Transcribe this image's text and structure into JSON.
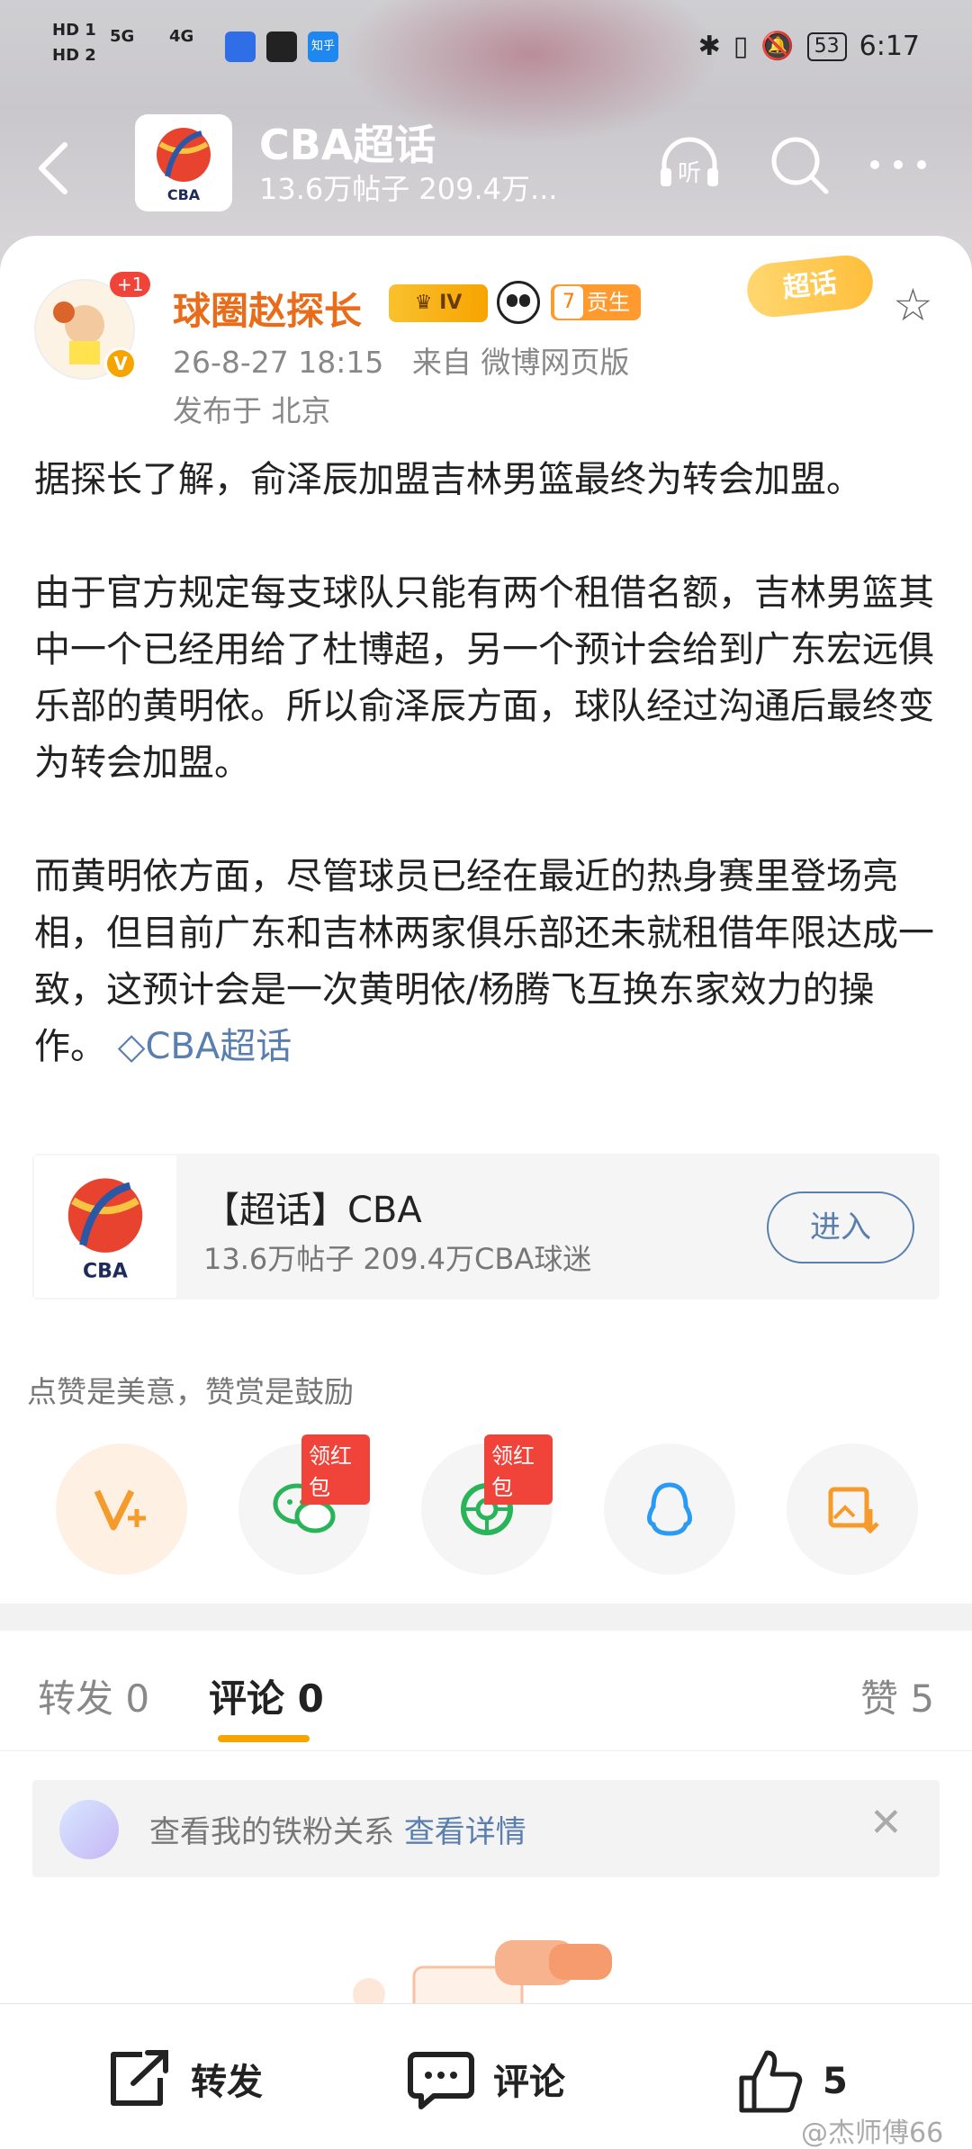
{
  "status_bar": {
    "hd1": "HD 1",
    "hd2": "HD 2",
    "net1": "5G",
    "net2": "4G",
    "zhihu": "知乎",
    "battery": "53",
    "time": "6:17"
  },
  "header": {
    "title": "CBA超话",
    "subtitle": "13.6万帖子 209.4万...",
    "logo_text": "CBA",
    "listen_label": "听"
  },
  "post": {
    "author": "球圈赵探长",
    "avatar_badge": "+1",
    "verified": "V",
    "level": "IV",
    "contrib_num": "7",
    "contrib_label": "贡生",
    "time": "26-8-27 18:15",
    "source": "来自 微博网页版",
    "location": "发布于 北京",
    "chaohua_tag": "超话",
    "paragraphs": [
      "据探长了解，俞泽辰加盟吉林男篮最终为转会加盟。",
      "由于官方规定每支球队只能有两个租借名额，吉林男篮其中一个已经用给了杜博超，另一个预计会给到广东宏远俱乐部的黄明依。所以俞泽辰方面，球队经过沟通后最终变为转会加盟。",
      "而黄明依方面，尽管球员已经在最近的热身赛里登场亮相，但目前广东和吉林两家俱乐部还未就租借年限达成一致，这预计会是一次黄明依/杨腾飞互换东家效力的操作。"
    ],
    "topic_link": "CBA超话"
  },
  "super_topic": {
    "title": "【超话】CBA",
    "stats": "13.6万帖子 209.4万CBA球迷",
    "enter_label": "进入"
  },
  "share": {
    "tip": "点赞是美意，赞赏是鼓励",
    "red_packet_label": "领红包"
  },
  "tabs": {
    "repost": "转发 0",
    "comment": "评论 0",
    "like": "赞 5"
  },
  "fan_banner": {
    "text": "查看我的铁粉关系",
    "link": "查看详情"
  },
  "bottom_bar": {
    "repost": "转发",
    "comment": "评论",
    "like_count": "5"
  },
  "watermark": "@杰师傅66",
  "colors": {
    "accent_orange": "#f7a400",
    "username": "#e86c1a",
    "link_blue": "#5a7fae",
    "red": "#f0443b"
  }
}
